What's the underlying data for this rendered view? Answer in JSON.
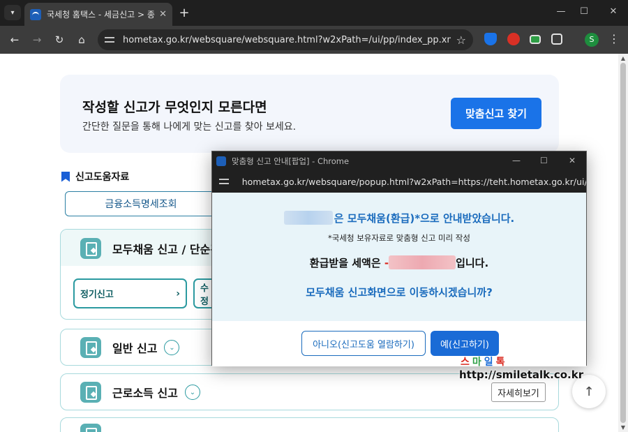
{
  "browser": {
    "tab_title": "국세청 홈택스 - 세금신고 > 종",
    "url": "hometax.go.kr/websquare/websquare.html?w2xPath=/ui/pp/index_pp.xml&men...",
    "profile_initial": "S",
    "icons": [
      "tab-search-icon",
      "back-icon",
      "forward-icon",
      "reload-icon",
      "home-icon",
      "site-settings-icon",
      "bookmark-star-icon",
      "shield-extension-icon",
      "hand-extension-icon",
      "green-extension-icon",
      "extensions-puzzle-icon",
      "profile-avatar",
      "menu-icon"
    ]
  },
  "banner": {
    "title": "작성할 신고가 무엇인지 모른다면",
    "subtitle": "간단한 질문을 통해 나에게 맞는 신고를 찾아 보세요.",
    "button": "맞춤신고 찾기"
  },
  "section": {
    "title": "신고도움자료",
    "button": "금융소득명세조회"
  },
  "cards": [
    {
      "title": "모두채움 신고 / 단순경",
      "sub_buttons": [
        "정기신고",
        "수정"
      ]
    },
    {
      "title": "일반 신고"
    },
    {
      "title": "근로소득 신고",
      "detail": "자세히보기"
    }
  ],
  "popup": {
    "window_title": "맞춤형 신고 안내[팝업] - Chrome",
    "url": "hometax.go.kr/websquare/popup.html?w2xPath=https://teht.hometax.go.kr/ui/rn/a/...",
    "line1": "은 모두채움(환급)*으로 안내받았습니다.",
    "line2": "*국세청 보유자료로 맞춤형 신고 미리 작성",
    "line3_prefix": "환급받을 세액은 ",
    "line3_minus": "-",
    "line3_suffix": "입니다.",
    "line4": "모두채움 신고화면으로 이동하시겠습니까?",
    "button_no": "아니오(신고도움 열람하기)",
    "button_yes": "예(신고하기)"
  },
  "watermark": {
    "top": [
      "스",
      "마",
      "일",
      "톡"
    ],
    "bottom": "http://smiletalk.co.kr"
  },
  "colors": {
    "accent": "#1a73e8",
    "teal": "#2b9aa0",
    "popup_text": "#1a6bbd",
    "amount_red": "#d9261c"
  }
}
